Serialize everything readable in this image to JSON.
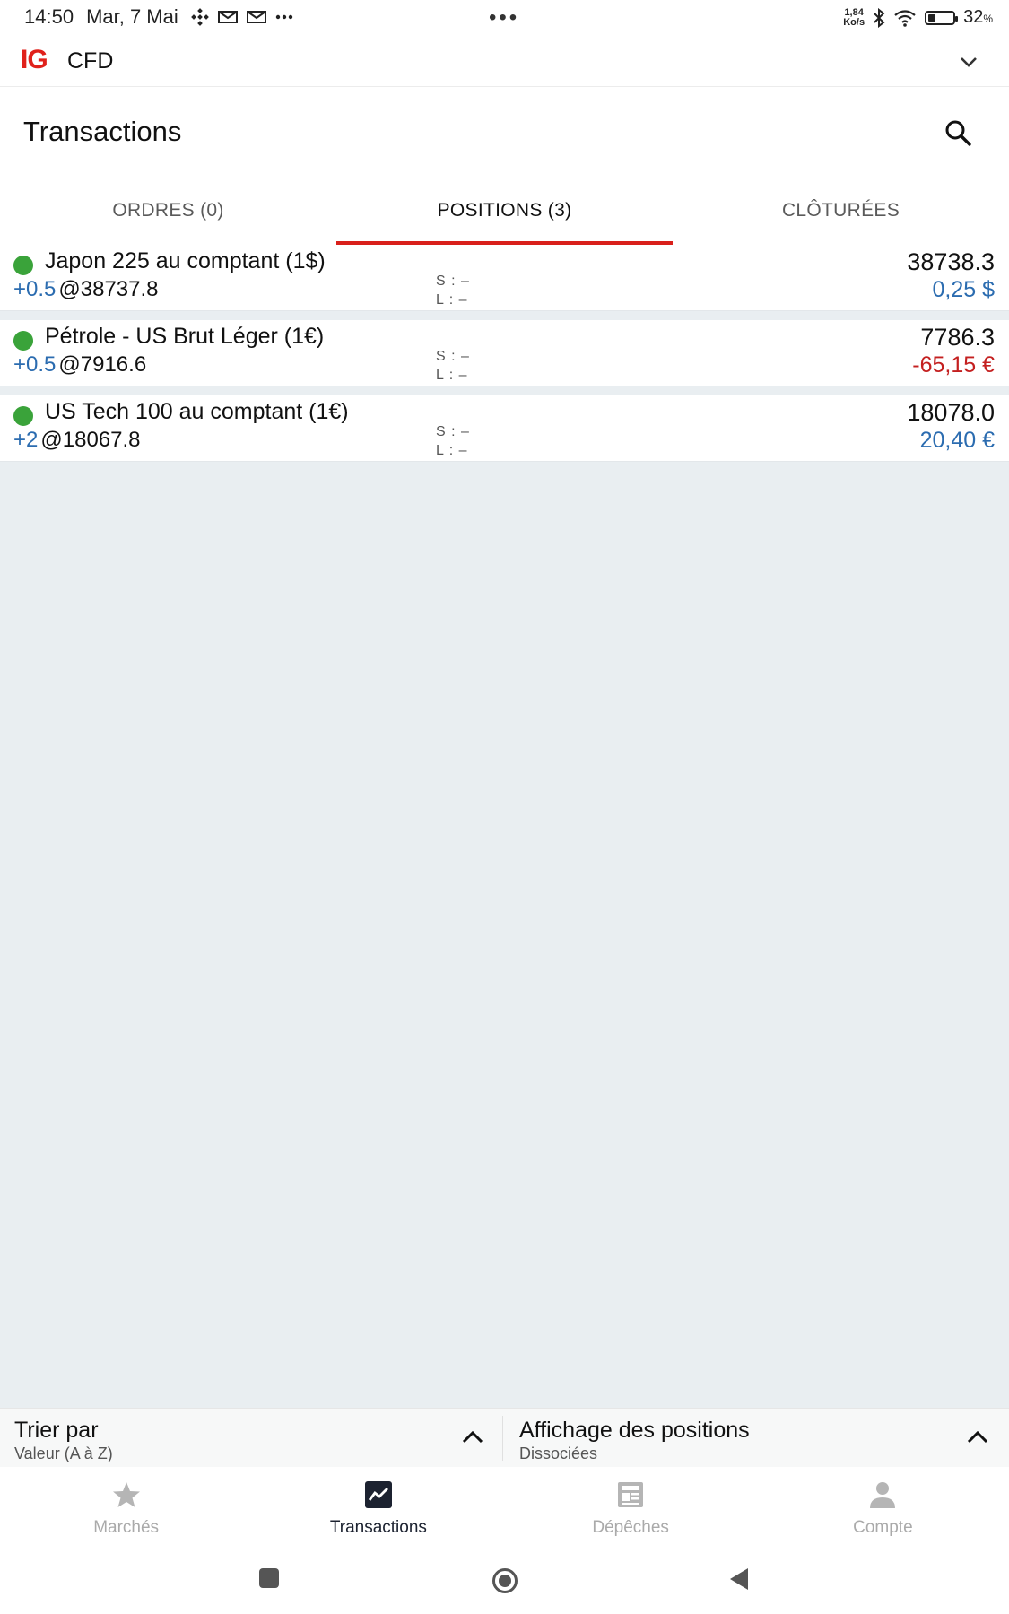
{
  "status_bar": {
    "time": "14:50",
    "date": "Mar, 7 Mai",
    "more_dots": "•••",
    "net_speed_value": "1,84",
    "net_speed_unit": "Ko/s",
    "battery_percent": "32",
    "battery_percent_sign": "%",
    "battery_level": 0.32
  },
  "app_bar": {
    "logo": "IG",
    "title": "CFD"
  },
  "header": {
    "title": "Transactions"
  },
  "tabs": [
    {
      "label": "ORDRES (0)",
      "active": false
    },
    {
      "label": "POSITIONS (3)",
      "active": true
    },
    {
      "label": "CLÔTURÉES",
      "active": false
    }
  ],
  "positions": [
    {
      "name": "Japon 225 au comptant (1$)",
      "size": "+0.5",
      "at": "@",
      "open_price": "38737.8",
      "stop": "S : –",
      "limit": "L : –",
      "price": "38738.3",
      "pnl": "0,25 $",
      "pnl_sign": "positive"
    },
    {
      "name": "Pétrole - US Brut Léger (1€)",
      "size": "+0.5",
      "at": "@",
      "open_price": "7916.6",
      "stop": "S : –",
      "limit": "L : –",
      "price": "7786.3",
      "pnl": "-65,15 €",
      "pnl_sign": "negative"
    },
    {
      "name": "US Tech 100 au comptant (1€)",
      "size": "+2",
      "at": "@",
      "open_price": "18067.8",
      "stop": "S : –",
      "limit": "L : –",
      "price": "18078.0",
      "pnl": "20,40 €",
      "pnl_sign": "positive"
    }
  ],
  "sort_bar": {
    "sort_title": "Trier par",
    "sort_value": "Valeur (A à Z)",
    "display_title": "Affichage des positions",
    "display_value": "Dissociées"
  },
  "bottom_nav": [
    {
      "label": "Marchés",
      "icon": "star-icon",
      "active": false
    },
    {
      "label": "Transactions",
      "icon": "chart-icon",
      "active": true
    },
    {
      "label": "Dépêches",
      "icon": "news-icon",
      "active": false
    },
    {
      "label": "Compte",
      "icon": "person-icon",
      "active": false
    }
  ],
  "colors": {
    "accent_red": "#d9201b",
    "positive_blue": "#2b6cb0",
    "negative_red": "#c42020",
    "status_green": "#3aa33a",
    "list_background": "#e9eef1"
  }
}
